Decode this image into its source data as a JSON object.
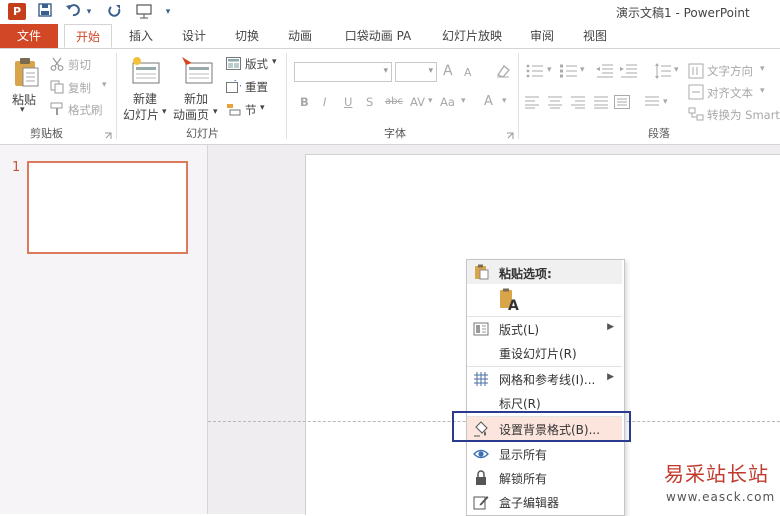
{
  "window": {
    "title": "演示文稿1 - PowerPoint",
    "app_icon": "P"
  },
  "quick_access": {
    "icons": [
      "save-icon",
      "undo-icon",
      "redo-icon",
      "slideshow-icon",
      "customize-icon"
    ]
  },
  "tabs": [
    {
      "label": "文件"
    },
    {
      "label": "开始"
    },
    {
      "label": "插入"
    },
    {
      "label": "设计"
    },
    {
      "label": "切换"
    },
    {
      "label": "动画"
    },
    {
      "label": "口袋动画 PA"
    },
    {
      "label": "幻灯片放映"
    },
    {
      "label": "审阅"
    },
    {
      "label": "视图"
    }
  ],
  "clipboard": {
    "paste": "粘贴",
    "cut": "剪切",
    "copy": "复制",
    "format_painter": "格式刷",
    "group_label": "剪贴板"
  },
  "slides_group": {
    "new_slide_l1": "新建",
    "new_slide_l2": "幻灯片",
    "new_anim_l1": "新加",
    "new_anim_l2": "动画页",
    "layout": "版式",
    "reset": "重置",
    "section": "节",
    "group_label": "幻灯片"
  },
  "font_group": {
    "bold": "B",
    "italic": "I",
    "underline": "U",
    "shadow": "S",
    "strike": "abc",
    "spacing": "AV",
    "case": "Aa",
    "grow": "A",
    "shrink": "A",
    "color": "A",
    "group_label": "字体"
  },
  "paragraph_group": {
    "text_direction": "文字方向",
    "align_text": "对齐文本",
    "convert_smartart": "转换为 SmartArt",
    "group_label": "段落"
  },
  "thumbnails": [
    {
      "number": "1"
    }
  ],
  "context_menu": {
    "paste_options_header": "粘贴选项:",
    "items": [
      {
        "label": "版式(L)",
        "submenu": true
      },
      {
        "label": "重设幻灯片(R)",
        "submenu": false
      },
      {
        "label": "网格和参考线(I)...",
        "submenu": true
      },
      {
        "label": "标尺(R)",
        "submenu": false
      },
      {
        "label": "设置背景格式(B)...",
        "submenu": false,
        "highlighted": true
      },
      {
        "label": "显示所有",
        "submenu": false
      },
      {
        "label": "解锁所有",
        "submenu": false
      },
      {
        "label": "盒子编辑器",
        "submenu": false
      }
    ]
  },
  "watermark": {
    "line1": "易采站长站",
    "line2": "www.easck.com"
  },
  "colors": {
    "accent": "#d24726",
    "highlight_border": "#2b3a8c",
    "highlight_fill": "#fbe5dc"
  }
}
